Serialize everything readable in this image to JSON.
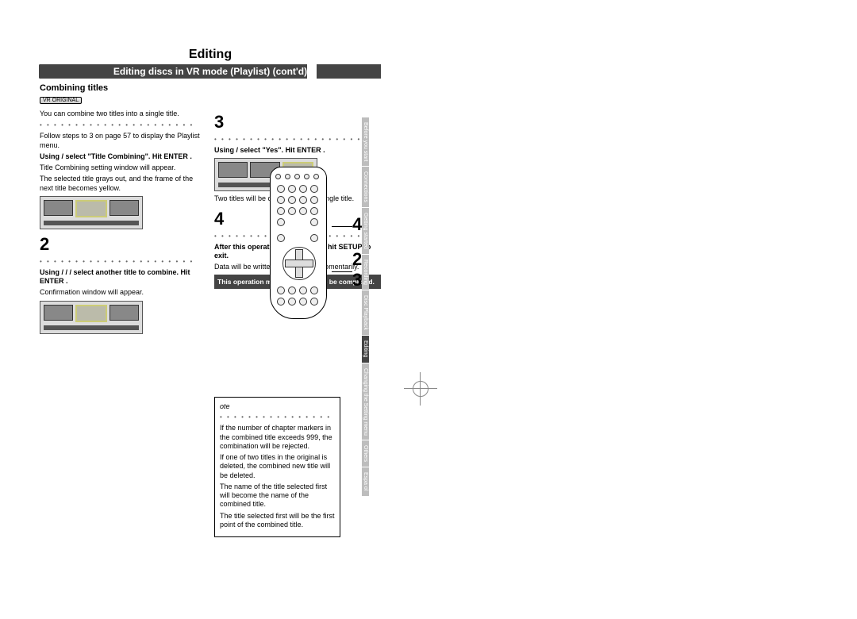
{
  "header": {
    "title": "Editing",
    "subtitle": "Editing discs in VR mode (Playlist) (cont'd)"
  },
  "section": {
    "heading": "Combining titles",
    "badge": "VR ORIGINAL"
  },
  "col1": {
    "intro": "You can combine two titles into a single title.",
    "step1a": "Follow steps  to 3 on page 57 to display the Playlist menu.",
    "step1b_bold": "Using  /  select \"Title Combining\". Hit  ENTER .",
    "step1c": "Title Combining setting window will appear.",
    "step1d": "The selected title grays out, and the frame of the next title becomes yellow.",
    "step2num": "2",
    "step2a_bold": "Using  /  /  /  select another title to combine. Hit  ENTER .",
    "step2b": "Confirmation window will appear."
  },
  "col2": {
    "step3num": "3",
    "step3a_bold": "Using  /  select \"Yes\". Hit  ENTER .",
    "step3b": "Two titles will be combined into a single title.",
    "step4num": "4",
    "step4a_bold": "After this operation is completed hit  SETUP  to exit.",
    "step4b": "Data will be written onto the disc momentarily.",
    "warn": "This operation may take a while to be completed."
  },
  "remote_side": {
    "n4": "4",
    "n2": "2",
    "n3": "3"
  },
  "note": {
    "label": "ote",
    "b1": "If the number of chapter markers in the combined title exceeds 999, the combination will be rejected.",
    "b2": "If one of two titles in the original is deleted, the combined new title will be deleted.",
    "b3": "The name of the title selected first will become the name of the combined title.",
    "b4": "The title selected first will be the first point of the combined title."
  },
  "tabs": {
    "t1": "Before you start",
    "t2": "Connections",
    "t3": "Getting started",
    "t4": "Recording",
    "t5": "Disc Playback",
    "t6": "Editing",
    "t7": "Changing the Setting menu",
    "t8": "Others",
    "t9": "Espa ol"
  }
}
